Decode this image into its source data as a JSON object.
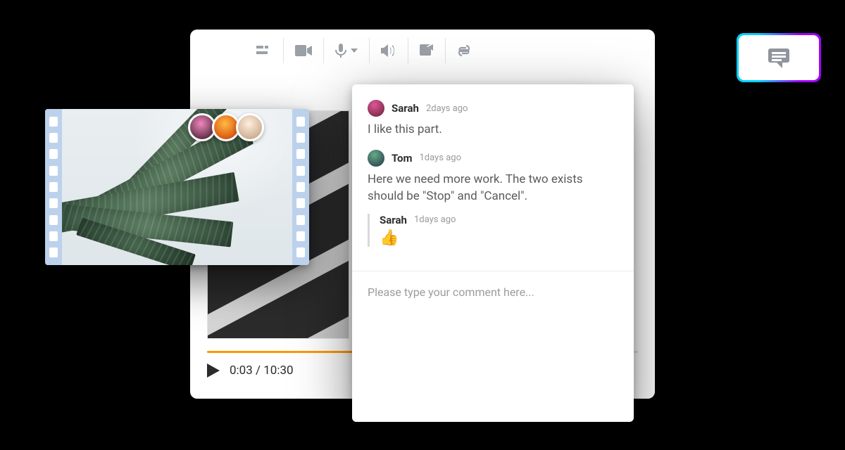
{
  "toolbar": {
    "items": [
      {
        "name": "align-icon"
      },
      {
        "name": "video-icon"
      },
      {
        "name": "microphone-icon",
        "dropdown": true
      },
      {
        "name": "volume-icon"
      },
      {
        "name": "share-icon"
      },
      {
        "name": "attach-icon"
      }
    ],
    "comment_button": {
      "name": "comment-icon"
    }
  },
  "playback": {
    "current": "0:03",
    "total": "10:30",
    "separator": " / "
  },
  "comments": [
    {
      "author": "Sarah",
      "time": "2days ago",
      "body": "I like this part.",
      "replies": []
    },
    {
      "author": "Tom",
      "time": "1days ago",
      "body": "Here we need more work. The two exists should be \"Stop\" and \"Cancel\".",
      "replies": [
        {
          "author": "Sarah",
          "time": "1days ago",
          "body": "👍"
        }
      ]
    }
  ],
  "comment_input": {
    "placeholder": "Please type your comment here..."
  },
  "clip": {
    "collaborators": [
      "user-1",
      "user-2",
      "user-3"
    ]
  }
}
